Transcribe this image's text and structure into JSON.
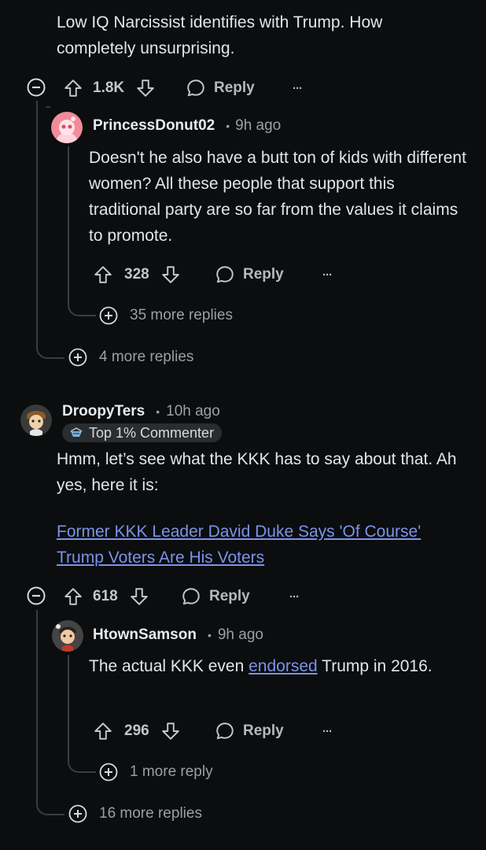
{
  "comment_a": {
    "body": "Low IQ Narcissist identifies with Trump. How completely unsurprising.",
    "votes": "1.8K",
    "reply_label": "Reply",
    "more_label": "···"
  },
  "reply_a1": {
    "username": "PrincessDonut02",
    "time": "9h ago",
    "body": "Doesn't he also have a butt ton of kids with different women? All these people that support this traditional party are so far from the values it claims to promote.",
    "votes": "328",
    "reply_label": "Reply",
    "more_label": "···",
    "more_replies": "35 more replies"
  },
  "comment_a_more": "4 more replies",
  "comment_b": {
    "username": "DroopyTers",
    "time": "10h ago",
    "badge": "Top 1% Commenter",
    "body": "Hmm, let’s see what the KKK has to say about that. Ah yes, here it is:",
    "link_text": "Former KKK Leader David Duke Says 'Of Course' Trump Voters Are His Voters",
    "votes": "618",
    "reply_label": "Reply",
    "more_label": "···"
  },
  "reply_b1": {
    "username": "HtownSamson",
    "time": "9h ago",
    "body_before": "The actual KKK even ",
    "body_link": "endorsed",
    "body_after": " Trump in 2016.",
    "votes": "296",
    "reply_label": "Reply",
    "more_label": "···",
    "more_replies": "1 more reply"
  },
  "comment_b_more": "16 more replies",
  "colors": {
    "background": "#0b0d0e",
    "link": "#7c93e8",
    "text": "#e3e6e8",
    "muted": "#9ba0a4",
    "thread_line": "#3a3d40"
  },
  "icons": [
    "collapse-icon",
    "upvote-icon",
    "downvote-icon",
    "reply-bubble-icon",
    "more-icon",
    "expand-plus-icon"
  ]
}
